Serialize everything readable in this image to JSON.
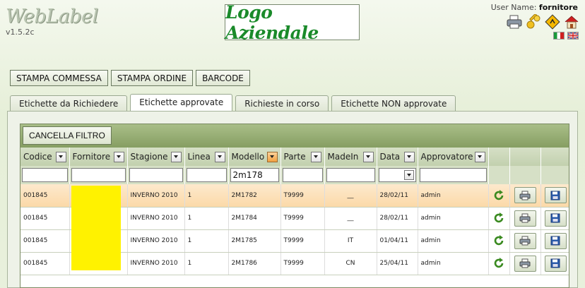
{
  "brand": {
    "name": "WebLabel",
    "version": "v1.5.2c"
  },
  "logo": {
    "text": "Logo Aziendale"
  },
  "user": {
    "label": "User Name:",
    "name": "fornitore"
  },
  "top_icons": [
    "printer-icon",
    "key-icon",
    "road-sign-icon",
    "home-icon"
  ],
  "flags": [
    "italy-flag",
    "uk-flag"
  ],
  "top_buttons": {
    "stampa_commessa": "STAMPA COMMESSA",
    "stampa_ordine": "STAMPA ORDINE",
    "barcode": "BARCODE"
  },
  "tabs": {
    "richiedere": "Etichette da Richiedere",
    "approvate": "Etichette approvate",
    "in_corso": "Richieste in corso",
    "non_approvate": "Etichette NON approvate"
  },
  "grid": {
    "filter_button": "CANCELLA FILTRO",
    "columns": {
      "codice": "Codice",
      "fornitore": "Fornitore",
      "stagione": "Stagione",
      "linea": "Linea",
      "modello": "Modello",
      "parte": "Parte",
      "madein": "MadeIn",
      "data": "Data",
      "approvatore": "Approvatore"
    },
    "filters": {
      "codice": "",
      "fornitore": "",
      "stagione": "",
      "linea": "",
      "modello": "2m178",
      "parte": "",
      "madein": "",
      "approvatore": ""
    },
    "rows": [
      {
        "codice": "001845",
        "fornitore": "",
        "stagione": "INVERNO 2010",
        "linea": "1",
        "modello": "2M1782",
        "parte": "T9999",
        "madein": "__",
        "data": "28/02/11",
        "approvatore": "admin"
      },
      {
        "codice": "001845",
        "fornitore": "",
        "stagione": "INVERNO 2010",
        "linea": "1",
        "modello": "2M1784",
        "parte": "T9999",
        "madein": "__",
        "data": "28/02/11",
        "approvatore": "admin"
      },
      {
        "codice": "001845",
        "fornitore": "",
        "stagione": "INVERNO 2010",
        "linea": "1",
        "modello": "2M1785",
        "parte": "T9999",
        "madein": "IT",
        "data": "01/04/11",
        "approvatore": "admin"
      },
      {
        "codice": "001845",
        "fornitore": "",
        "stagione": "INVERNO 2010",
        "linea": "1",
        "modello": "2M1786",
        "parte": "T9999",
        "madein": "CN",
        "data": "25/04/11",
        "approvatore": "admin"
      }
    ]
  },
  "colors": {
    "accent_green": "#869e62",
    "selected_row": "#fbd9a8",
    "redacted": "#fff200"
  }
}
